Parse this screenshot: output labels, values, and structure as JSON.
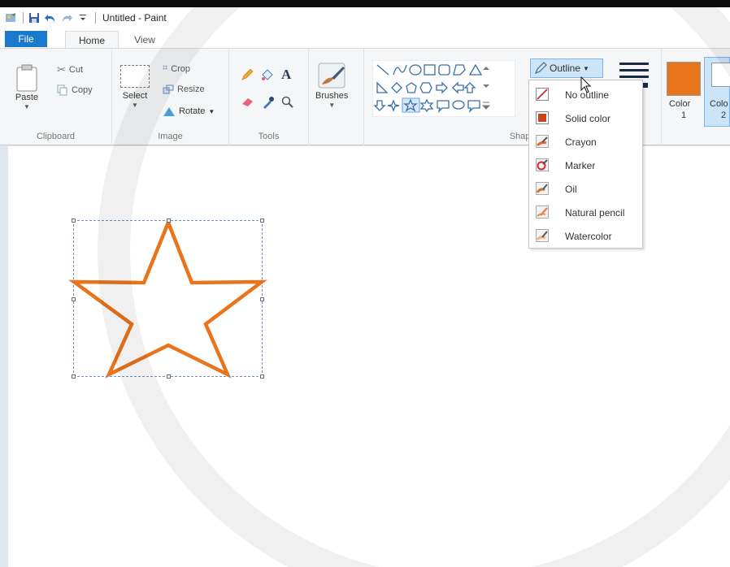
{
  "titlebar": {
    "title": "Untitled - Paint",
    "quick_access": [
      "paint-app-icon",
      "save-icon",
      "undo-icon",
      "redo-icon",
      "customize-qa-icon"
    ]
  },
  "tabs": {
    "file": "File",
    "home": "Home",
    "view": "View"
  },
  "ribbon": {
    "clipboard": {
      "label": "Clipboard",
      "paste": "Paste",
      "cut": "Cut",
      "copy": "Copy"
    },
    "image": {
      "label": "Image",
      "select": "Select",
      "crop": "Crop",
      "resize": "Resize",
      "rotate": "Rotate"
    },
    "tools": {
      "label": "Tools",
      "text_tool": "A"
    },
    "brushes": {
      "label": "Brushes"
    },
    "shapes": {
      "label": "Shapes",
      "outline": "Outline"
    },
    "colors": {
      "color1_label": "Color",
      "color1_num": "1",
      "color2_label": "Colo",
      "color2_num": "2",
      "color1": "#e8741c",
      "color2": "#ffffff"
    }
  },
  "outline_menu": {
    "items": [
      {
        "label": "No outline",
        "icon": "no-outline-icon"
      },
      {
        "label": "Solid color",
        "icon": "solid-color-icon"
      },
      {
        "label": "Crayon",
        "icon": "crayon-icon"
      },
      {
        "label": "Marker",
        "icon": "marker-icon"
      },
      {
        "label": "Oil",
        "icon": "oil-icon"
      },
      {
        "label": "Natural pencil",
        "icon": "natural-pencil-icon"
      },
      {
        "label": "Watercolor",
        "icon": "watercolor-icon"
      }
    ]
  },
  "canvas": {
    "shape": "star",
    "stroke_color": "#e8741c"
  }
}
